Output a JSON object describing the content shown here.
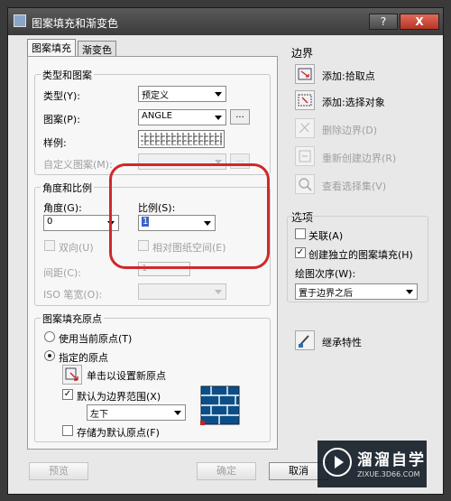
{
  "window": {
    "title": "图案填充和渐变色",
    "help_label": "?",
    "close_label": "X"
  },
  "tabs": [
    {
      "label": "图案填充"
    },
    {
      "label": "渐变色"
    }
  ],
  "type_pattern": {
    "group_title": "类型和图案",
    "type_label": "类型(Y):",
    "type_value": "预定义",
    "pattern_label": "图案(P):",
    "pattern_value": "ANGLE",
    "browse_label": "...",
    "sample_label": "样例:",
    "custom_label": "自定义图案(M):",
    "custom_browse_label": "..."
  },
  "angle_scale": {
    "group_title": "角度和比例",
    "angle_label": "角度(G):",
    "angle_value": "0",
    "scale_label": "比例(S):",
    "scale_value": "1",
    "double_label": "双向(U)",
    "relative_label": "相对图纸空间(E)",
    "spacing_label": "间距(C):",
    "spacing_value": "1",
    "iso_label": "ISO 笔宽(O):"
  },
  "origin": {
    "group_title": "图案填充原点",
    "use_current_label": "使用当前原点(T)",
    "specified_label": "指定的原点",
    "click_set_label": "单击以设置新原点",
    "default_extent_label": "默认为边界范围(X)",
    "position_value": "左下",
    "store_default_label": "存储为默认原点(F)"
  },
  "boundaries": {
    "group_title": "边界",
    "add_pick_label": "添加:拾取点",
    "add_select_label": "添加:选择对象",
    "remove_label": "删除边界(D)",
    "recreate_label": "重新创建边界(R)",
    "view_sel_label": "查看选择集(V)"
  },
  "options": {
    "group_title": "选项",
    "associative_label": "关联(A)",
    "independent_label": "创建独立的图案填充(H)",
    "draw_order_label": "绘图次序(W):",
    "draw_order_value": "置于边界之后"
  },
  "inherit_label": "继承特性",
  "footer": {
    "preview_label": "预览",
    "ok_label": "确定",
    "cancel_label": "取消"
  },
  "watermark": {
    "main_text": "溜溜自学",
    "sub_text": "ZIXUE.3D66.COM"
  },
  "colors": {
    "highlight": "#d0282a",
    "titlebar": "#3b3b3b"
  }
}
